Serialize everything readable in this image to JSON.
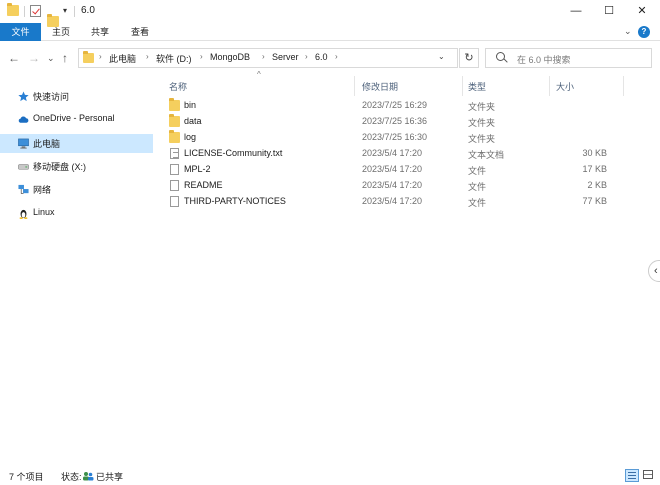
{
  "window": {
    "title": "6.0",
    "quick_access_dropdown": "▾",
    "minimize": "—",
    "maximize": "☐",
    "close": "✕"
  },
  "ribbon": {
    "tabs": [
      "文件",
      "主页",
      "共享",
      "查看"
    ],
    "collapse_chevron": "⌄",
    "help": "?"
  },
  "nav": {
    "back": "←",
    "forward": "→",
    "recent": "⌄",
    "up": "↑",
    "refresh": "↻",
    "breadcrumb": [
      "此电脑",
      "软件 (D:)",
      "MongoDB",
      "Server",
      "6.0"
    ],
    "breadcrumb_sep": "›",
    "address_dropdown": "⌄"
  },
  "search": {
    "placeholder": "在 6.0 中搜索"
  },
  "sidebar": {
    "items": [
      {
        "label": "快速访问",
        "icon": "star-icon",
        "selected": false
      },
      {
        "label": "OneDrive - Personal",
        "icon": "cloud-icon",
        "selected": false
      },
      {
        "label": "此电脑",
        "icon": "monitor-icon",
        "selected": true
      },
      {
        "label": "移动硬盘 (X:)",
        "icon": "drive-icon",
        "selected": false
      },
      {
        "label": "网络",
        "icon": "network-icon",
        "selected": false
      },
      {
        "label": "Linux",
        "icon": "linux-icon",
        "selected": false
      }
    ]
  },
  "columns": {
    "name": "名称",
    "date": "修改日期",
    "type": "类型",
    "size": "大小",
    "sort_indicator": "^"
  },
  "files": [
    {
      "name": "bin",
      "date": "2023/7/25 16:29",
      "type": "文件夹",
      "size": "",
      "kind": "folder"
    },
    {
      "name": "data",
      "date": "2023/7/25 16:36",
      "type": "文件夹",
      "size": "",
      "kind": "folder"
    },
    {
      "name": "log",
      "date": "2023/7/25 16:30",
      "type": "文件夹",
      "size": "",
      "kind": "folder"
    },
    {
      "name": "LICENSE-Community.txt",
      "date": "2023/5/4 17:20",
      "type": "文本文档",
      "size": "30 KB",
      "kind": "text"
    },
    {
      "name": "MPL-2",
      "date": "2023/5/4 17:20",
      "type": "文件",
      "size": "17 KB",
      "kind": "file"
    },
    {
      "name": "README",
      "date": "2023/5/4 17:20",
      "type": "文件",
      "size": "2 KB",
      "kind": "file"
    },
    {
      "name": "THIRD-PARTY-NOTICES",
      "date": "2023/5/4 17:20",
      "type": "文件",
      "size": "77 KB",
      "kind": "file"
    }
  ],
  "side_panel_arrow": "‹",
  "status": {
    "count": "7 个项目",
    "state_label": "状态:",
    "state_value": "已共享"
  },
  "colors": {
    "accent": "#1979ca",
    "selection": "#cce8ff",
    "folder": "#f5cf5e"
  }
}
